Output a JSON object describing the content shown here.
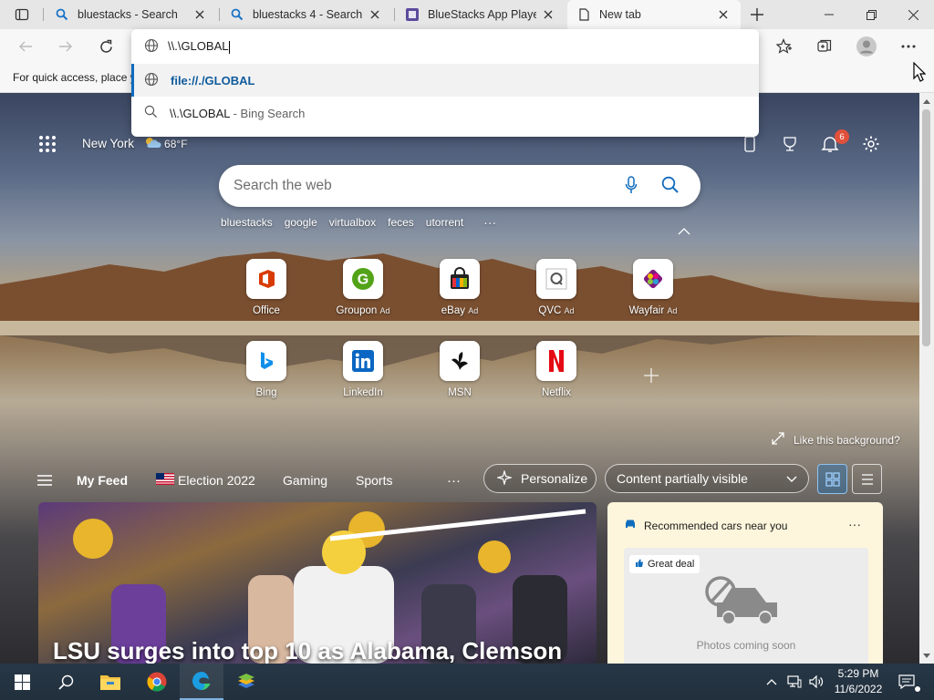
{
  "tabs": [
    {
      "title": "bluestacks - Search",
      "favicon": "bing-search-icon",
      "active": false
    },
    {
      "title": "bluestacks 4 - Search",
      "favicon": "bing-search-icon",
      "active": false
    },
    {
      "title": "BlueStacks App Player",
      "favicon": "bluestacks-icon",
      "active": false
    },
    {
      "title": "New tab",
      "favicon": "page-icon",
      "active": true
    }
  ],
  "omnibox": {
    "input_value": "\\\\.\\GLOBAL",
    "suggestions": [
      {
        "text": "file://./GLOBAL",
        "suffix": "",
        "icon": "globe-icon"
      },
      {
        "text": "\\\\.\\GLOBAL",
        "suffix": " - Bing Search",
        "icon": "search-icon"
      }
    ]
  },
  "favorites_bar": {
    "text": "For quick access, place y"
  },
  "ntp": {
    "location": "New York",
    "temperature": "68°F",
    "notification_count": "6",
    "search_placeholder": "Search the web",
    "trending": [
      "bluestacks",
      "google",
      "virtualbox",
      "feces",
      "utorrent"
    ],
    "more_label": "···",
    "tiles": [
      {
        "label": "Office",
        "ad": ""
      },
      {
        "label": "Groupon",
        "ad": "Ad"
      },
      {
        "label": "eBay",
        "ad": "Ad"
      },
      {
        "label": "QVC",
        "ad": "Ad"
      },
      {
        "label": "Wayfair",
        "ad": "Ad"
      },
      {
        "label": "Bing",
        "ad": ""
      },
      {
        "label": "LinkedIn",
        "ad": ""
      },
      {
        "label": "MSN",
        "ad": ""
      },
      {
        "label": "Netflix",
        "ad": ""
      }
    ],
    "like_background": "Like this background?"
  },
  "feed": {
    "nav": [
      "My Feed",
      "Election 2022",
      "Gaming",
      "Sports"
    ],
    "more": "···",
    "personalize": "Personalize",
    "content_visibility": "Content partially visible",
    "story_title": "LSU surges into top 10 as Alabama, Clemson",
    "cars_card": {
      "title": "Recommended cars near you",
      "menu": "···",
      "badge": "Great deal",
      "placeholder": "Photos coming soon"
    }
  },
  "taskbar": {
    "time": "5:29 PM",
    "date": "11/6/2022",
    "apps": [
      "start-icon",
      "search-icon",
      "file-explorer-icon",
      "chrome-icon",
      "edge-icon",
      "bluestacks-icon"
    ]
  },
  "colors": {
    "accent": "#0f6cbd",
    "taskbar": "#22303d",
    "notification_badge": "#e0503b",
    "netflix": "#e50914",
    "linkedin": "#0a66c2"
  }
}
